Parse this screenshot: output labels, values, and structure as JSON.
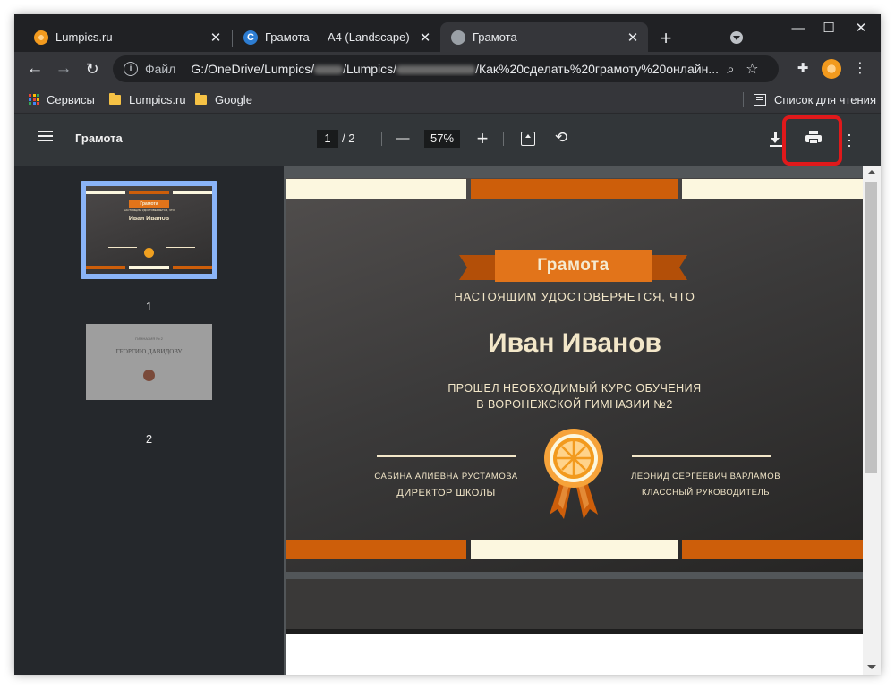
{
  "browser": {
    "tabs": [
      {
        "title": "Lumpics.ru",
        "close": "✕"
      },
      {
        "title": "Грамота — A4 (Landscape)",
        "close": "✕",
        "icon_letter": "C"
      },
      {
        "title": "Грамота",
        "close": "✕"
      }
    ],
    "new_tab": "+",
    "window_controls": {
      "minimize": "—",
      "maximize": "☐",
      "close": "✕"
    },
    "omnibox": {
      "scheme_label": "Файл",
      "url_part1": "G:/OneDrive/Lumpics/",
      "url_part2": "/Lumpics/",
      "url_part3": "/Как%20сделать%20грамоту%20онлайн..."
    },
    "bookmarks": [
      {
        "label": "Сервисы"
      },
      {
        "label": "Lumpics.ru"
      },
      {
        "label": "Google"
      }
    ],
    "reading_list": "Список для чтения"
  },
  "pdf": {
    "title": "Грамота",
    "current_page": "1",
    "page_total": "/ 2",
    "zoom": "57%",
    "zoom_out": "—",
    "zoom_in": "+",
    "thumbnails": [
      {
        "label": "1"
      },
      {
        "label": "2"
      }
    ]
  },
  "certificate": {
    "title": "Грамота",
    "subtitle": "НАСТОЯЩИМ УДОСТОВЕРЯЕТСЯ, ЧТО",
    "name": "Иван Иванов",
    "course_line1": "ПРОШЕЛ НЕОБХОДИМЫЙ КУРС ОБУЧЕНИЯ",
    "course_line2": "В ВОРОНЕЖСКОЙ ГИМНАЗИИ №2",
    "signer_left_name": "САБИНА АЛИЕВНА РУСТАМОВА",
    "signer_left_role": "ДИРЕКТОР ШКОЛЫ",
    "signer_right_name": "ЛЕОНИД СЕРГЕЕВИЧ ВАРЛАМОВ",
    "signer_right_role": "КЛАССНЫЙ РУКОВОДИТЕЛЬ"
  },
  "thumbnail1": {
    "title": "Грамота",
    "subtitle": "НАСТОЯЩИМ УДОСТОВЕРЯЕТСЯ, ЧТО",
    "name": "Иван Иванов"
  },
  "thumbnail2": {
    "line1": "ГИМНАЗИЯ № 2",
    "line2": "ГЕОРГИЮ ДАВИДОВУ"
  },
  "colors": {
    "highlight": "#e0191b",
    "cert_orange": "#cd5e0a",
    "cert_cream": "#fcf7df",
    "thumb_selected": "#8ab4f8"
  }
}
